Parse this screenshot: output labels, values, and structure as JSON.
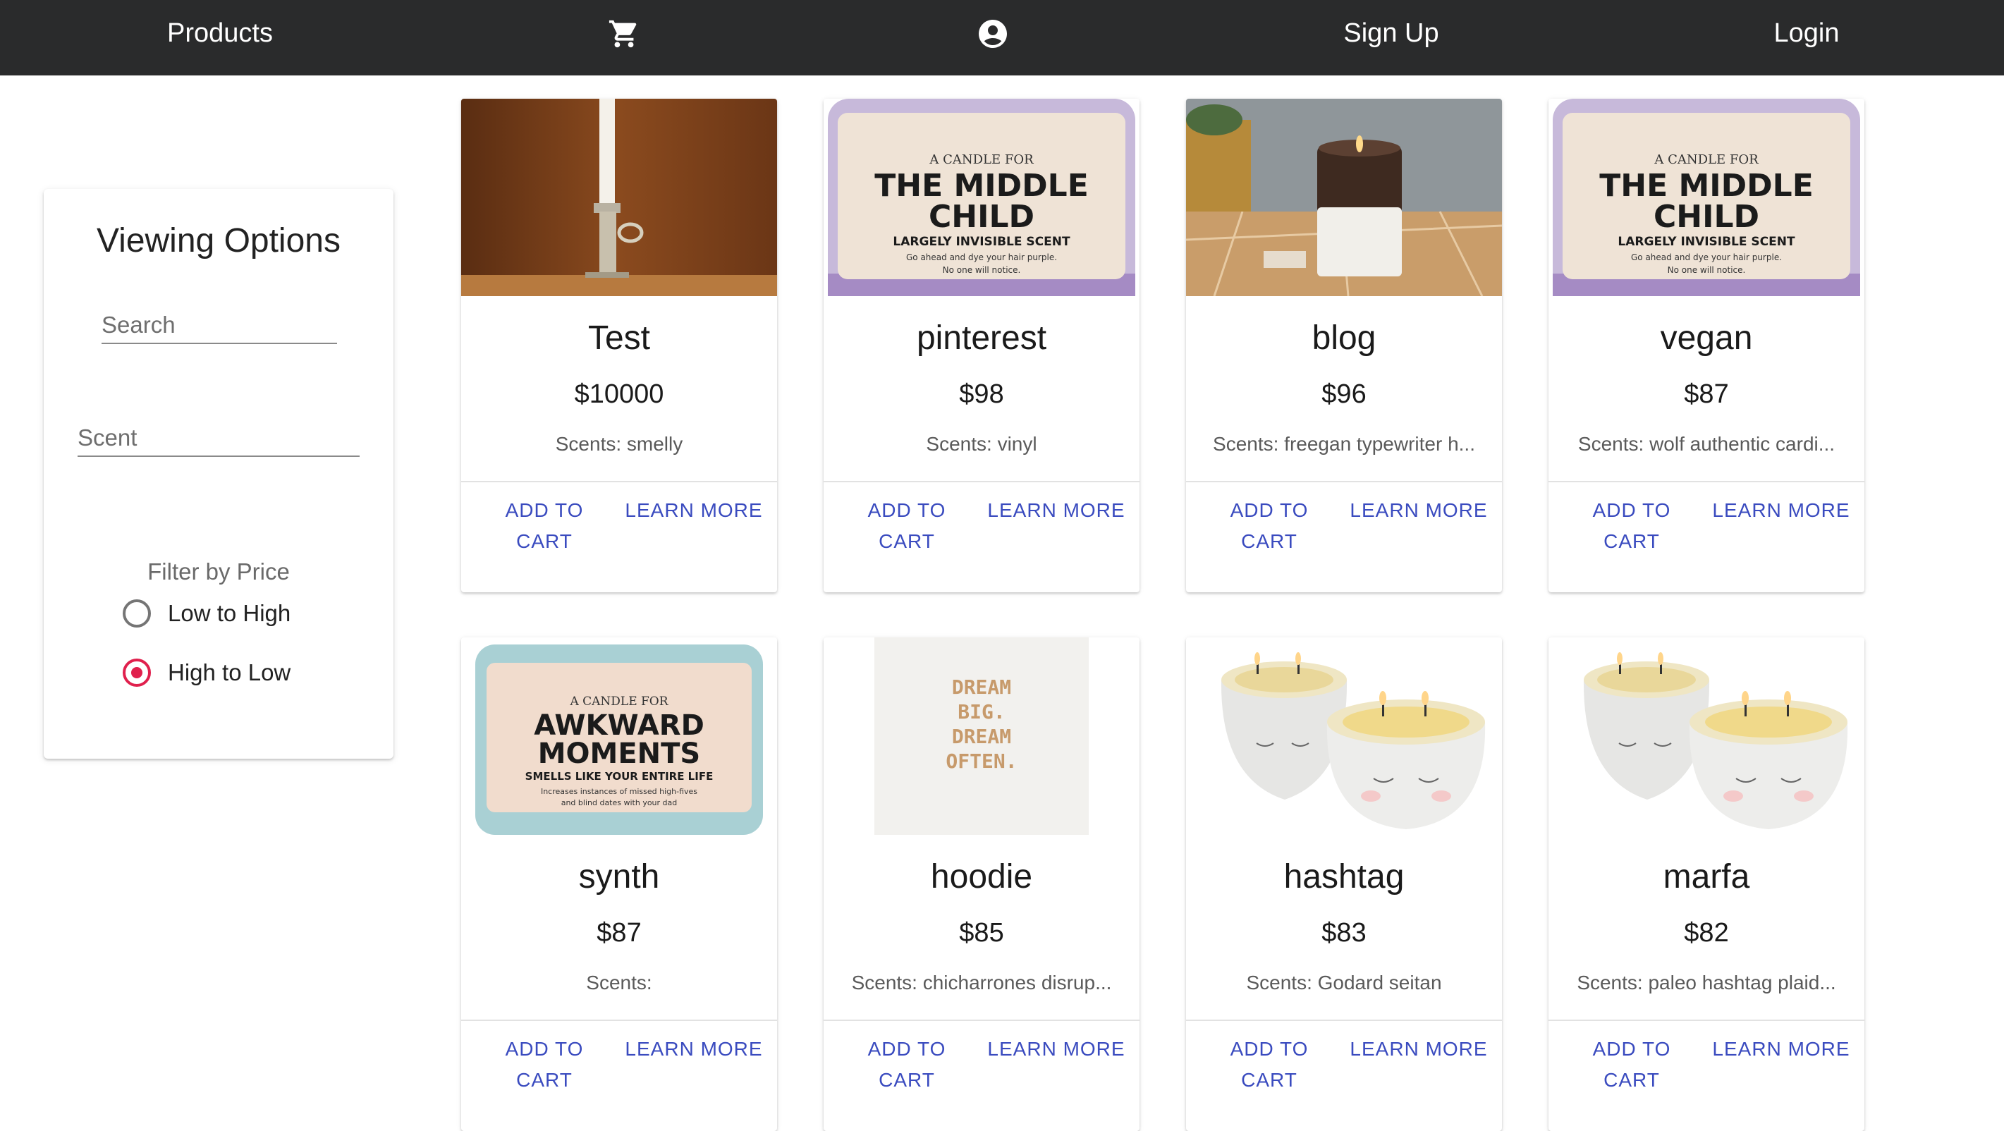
{
  "nav": {
    "products": "Products",
    "cart_icon": "cart-icon",
    "account_icon": "account-circle-icon",
    "signup": "Sign Up",
    "login": "Login"
  },
  "sidebar": {
    "title": "Viewing Options",
    "search_placeholder": "Search",
    "scent_placeholder": "Scent",
    "filter_title": "Filter by Price",
    "options": [
      {
        "label": "Low to High",
        "checked": false
      },
      {
        "label": "High to Low",
        "checked": true
      }
    ]
  },
  "colors": {
    "navbar": "#2a2b2c",
    "accent_button": "#3a4bbf",
    "radio_selected": "#e0204d"
  },
  "products": [
    {
      "name": "Test",
      "price": "$10000",
      "scents": "Scents: smelly",
      "add": "ADD TO CART",
      "learn": "LEARN MORE"
    },
    {
      "name": "pinterest",
      "price": "$98",
      "scents": "Scents: vinyl",
      "add": "ADD TO CART",
      "learn": "LEARN MORE"
    },
    {
      "name": "blog",
      "price": "$96",
      "scents": "Scents: freegan typewriter h...",
      "add": "ADD TO CART",
      "learn": "LEARN MORE"
    },
    {
      "name": "vegan",
      "price": "$87",
      "scents": "Scents: wolf authentic cardi...",
      "add": "ADD TO CART",
      "learn": "LEARN MORE"
    },
    {
      "name": "synth",
      "price": "$87",
      "scents": "Scents:",
      "add": "ADD TO CART",
      "learn": "LEARN MORE"
    },
    {
      "name": "hoodie",
      "price": "$85",
      "scents": "Scents: chicharrones disrup...",
      "add": "ADD TO CART",
      "learn": "LEARN MORE"
    },
    {
      "name": "hashtag",
      "price": "$83",
      "scents": "Scents: Godard seitan",
      "add": "ADD TO CART",
      "learn": "LEARN MORE"
    },
    {
      "name": "marfa",
      "price": "$82",
      "scents": "Scents: paleo hashtag plaid...",
      "add": "ADD TO CART",
      "learn": "LEARN MORE"
    }
  ],
  "images": {
    "middle_child_label": [
      "A CANDLE FOR",
      "THE MIDDLE",
      "CHILD",
      "LARGELY INVISIBLE SCENT",
      "Go ahead and dye your hair purple.",
      "No one will notice."
    ],
    "awkward_label": [
      "A CANDLE FOR",
      "AWKWARD",
      "MOMENTS",
      "SMELLS LIKE YOUR ENTIRE LIFE",
      "Increases instances of missed high-fives",
      "and blind dates with your dad"
    ],
    "dream_label": [
      "DREAM",
      "BIG.",
      "DREAM",
      "OFTEN."
    ]
  }
}
